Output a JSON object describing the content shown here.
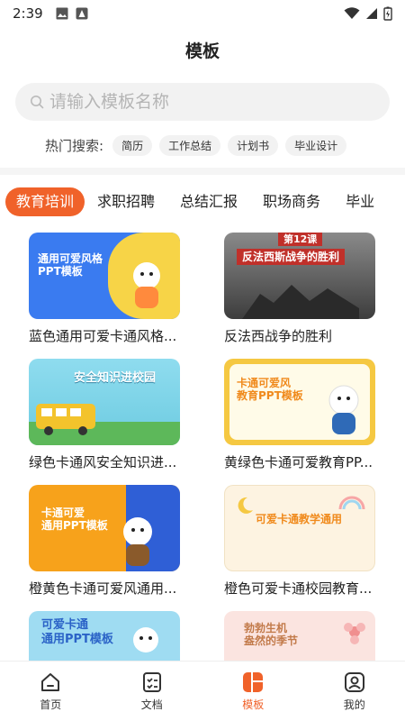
{
  "status_bar": {
    "time": "2:39"
  },
  "header": {
    "title": "模板"
  },
  "search": {
    "placeholder": "请输入模板名称"
  },
  "hot_search": {
    "label": "热门搜索:",
    "chips": [
      "简历",
      "工作总结",
      "计划书",
      "毕业设计"
    ]
  },
  "tabs": [
    "教育培训",
    "求职招聘",
    "总结汇报",
    "职场商务",
    "毕业"
  ],
  "active_tab": 0,
  "cards": [
    {
      "title": "蓝色通用可爱卡通风格...",
      "thumb_text": "通用可爱风格\nPPT模板",
      "bg": "#3a7bf0"
    },
    {
      "title": "反法西战争的胜利",
      "thumb_text": "反法西斯战争的胜利",
      "thumb_sub": "第12课",
      "bg": "#6b6b6b"
    },
    {
      "title": "绿色卡通风安全知识进...",
      "thumb_text": "安全知识进校园",
      "bg": "#7ed3e8"
    },
    {
      "title": "黄绿色卡通可爱教育PP...",
      "thumb_text": "卡通可爱风\n教育PPT模板",
      "bg": "#f5c842"
    },
    {
      "title": "橙黄色卡通可爱风通用...",
      "thumb_text": "卡通可爱\n通用PPT模板",
      "bg": "#f7a21b"
    },
    {
      "title": "橙色可爱卡通校园教育...",
      "thumb_text": "可爱卡通教学通用",
      "bg": "#fdf3e1"
    },
    {
      "title": "",
      "thumb_text": "可爱卡通\n通用PPT模板",
      "bg": "#9fdcf2"
    },
    {
      "title": "",
      "thumb_text": "勃勃生机\n盎然的季节",
      "bg": "#fbe4e0"
    }
  ],
  "bottom_nav": [
    {
      "label": "首页",
      "icon": "home-icon"
    },
    {
      "label": "文档",
      "icon": "document-icon"
    },
    {
      "label": "模板",
      "icon": "template-icon"
    },
    {
      "label": "我的",
      "icon": "profile-icon"
    }
  ],
  "active_nav": 2,
  "colors": {
    "accent": "#f0622a"
  }
}
